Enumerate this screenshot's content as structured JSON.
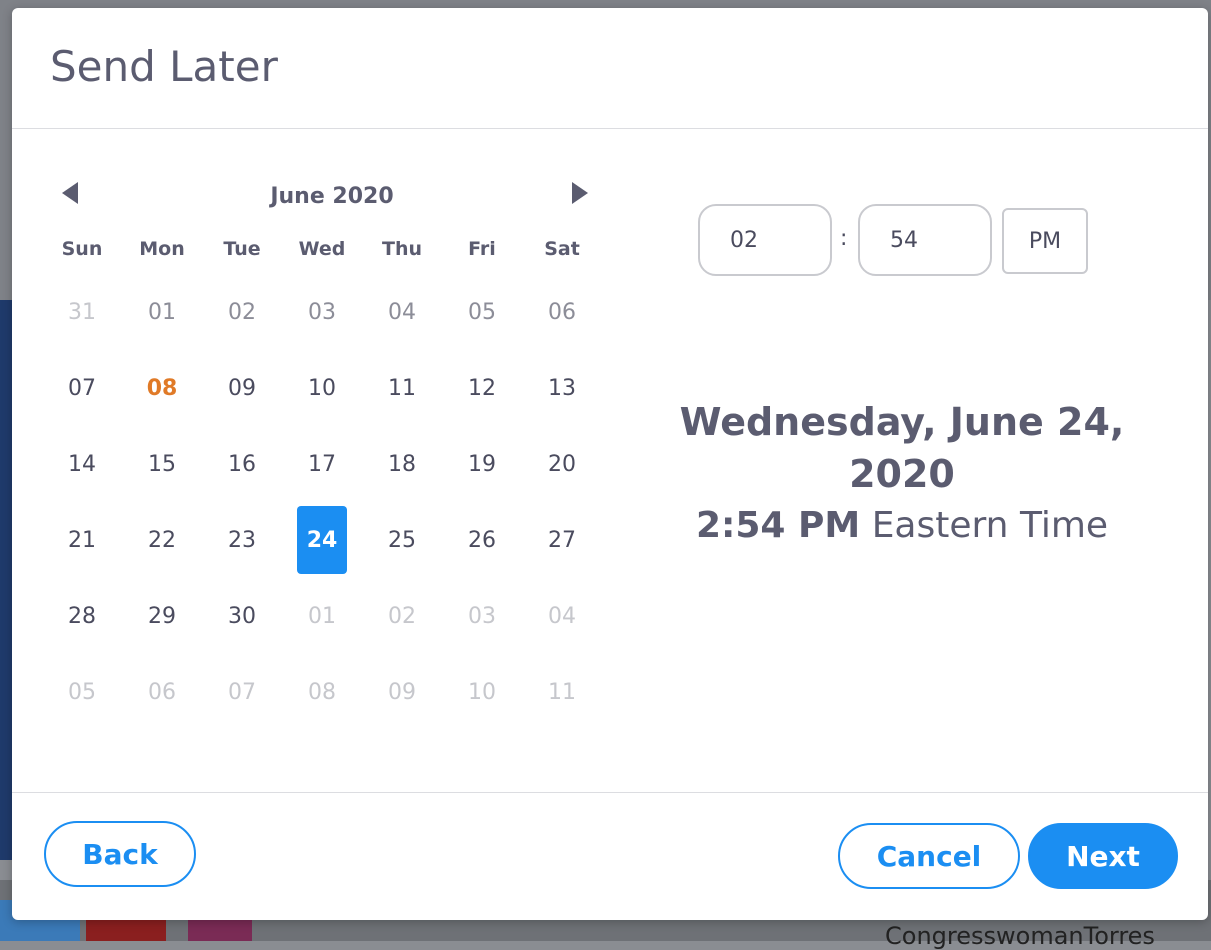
{
  "background": {
    "footer_text": "CongresswomanTorres"
  },
  "dialog": {
    "title": "Send Later"
  },
  "calendar": {
    "month_label": "June 2020",
    "weekdays": [
      "Sun",
      "Mon",
      "Tue",
      "Wed",
      "Thu",
      "Fri",
      "Sat"
    ],
    "weeks": [
      [
        "31",
        "01",
        "02",
        "03",
        "04",
        "05",
        "06"
      ],
      [
        "07",
        "08",
        "09",
        "10",
        "11",
        "12",
        "13"
      ],
      [
        "14",
        "15",
        "16",
        "17",
        "18",
        "19",
        "20"
      ],
      [
        "21",
        "22",
        "23",
        "24",
        "25",
        "26",
        "27"
      ],
      [
        "28",
        "29",
        "30",
        "01",
        "02",
        "03",
        "04"
      ],
      [
        "05",
        "06",
        "07",
        "08",
        "09",
        "10",
        "11"
      ]
    ],
    "today": "08",
    "selected": "24",
    "colors": {
      "today": "#e07a27",
      "selected": "#1b8ef2"
    }
  },
  "time": {
    "hour": "02",
    "separator": ":",
    "minute": "54",
    "period": "PM"
  },
  "summary": {
    "date_text": "Wednesday, June 24, 2020",
    "time_text": "2:54 PM",
    "timezone_text": "Eastern Time"
  },
  "footer": {
    "back_label": "Back",
    "cancel_label": "Cancel",
    "next_label": "Next"
  },
  "accent_color": "#1b8ef2"
}
